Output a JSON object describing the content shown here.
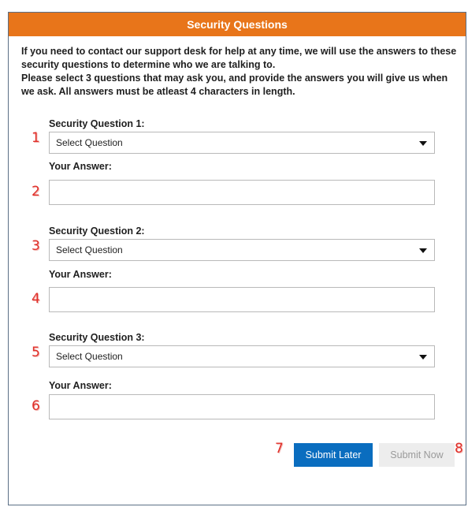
{
  "header": {
    "title": "Security Questions"
  },
  "intro": {
    "line1": "If you need to contact our support desk for help at any time, we will use the answers to these security questions to determine who we are talking to.",
    "line2": "Please select 3 questions that may ask you, and provide the answers you will give us when we ask. All answers must be atleast 4 characters in length."
  },
  "questions": [
    {
      "label": "Security Question 1:",
      "select_value": "Select Question",
      "answer_label": "Your Answer:",
      "answer_value": "",
      "select_marker": "1",
      "answer_marker": "2"
    },
    {
      "label": "Security Question 2:",
      "select_value": "Select Question",
      "answer_label": "Your Answer:",
      "answer_value": "",
      "select_marker": "3",
      "answer_marker": "4"
    },
    {
      "label": "Security Question 3:",
      "select_value": "Select Question",
      "answer_label": "Your Answer:",
      "answer_value": "",
      "select_marker": "5",
      "answer_marker": "6"
    }
  ],
  "buttons": {
    "submit_later": "Submit Later",
    "submit_now": "Submit Now",
    "submit_later_marker": "7",
    "submit_now_marker": "8"
  },
  "colors": {
    "header_bg": "#e8751a",
    "primary_button": "#0a6dbf",
    "annotation_marker": "#e0302a"
  }
}
